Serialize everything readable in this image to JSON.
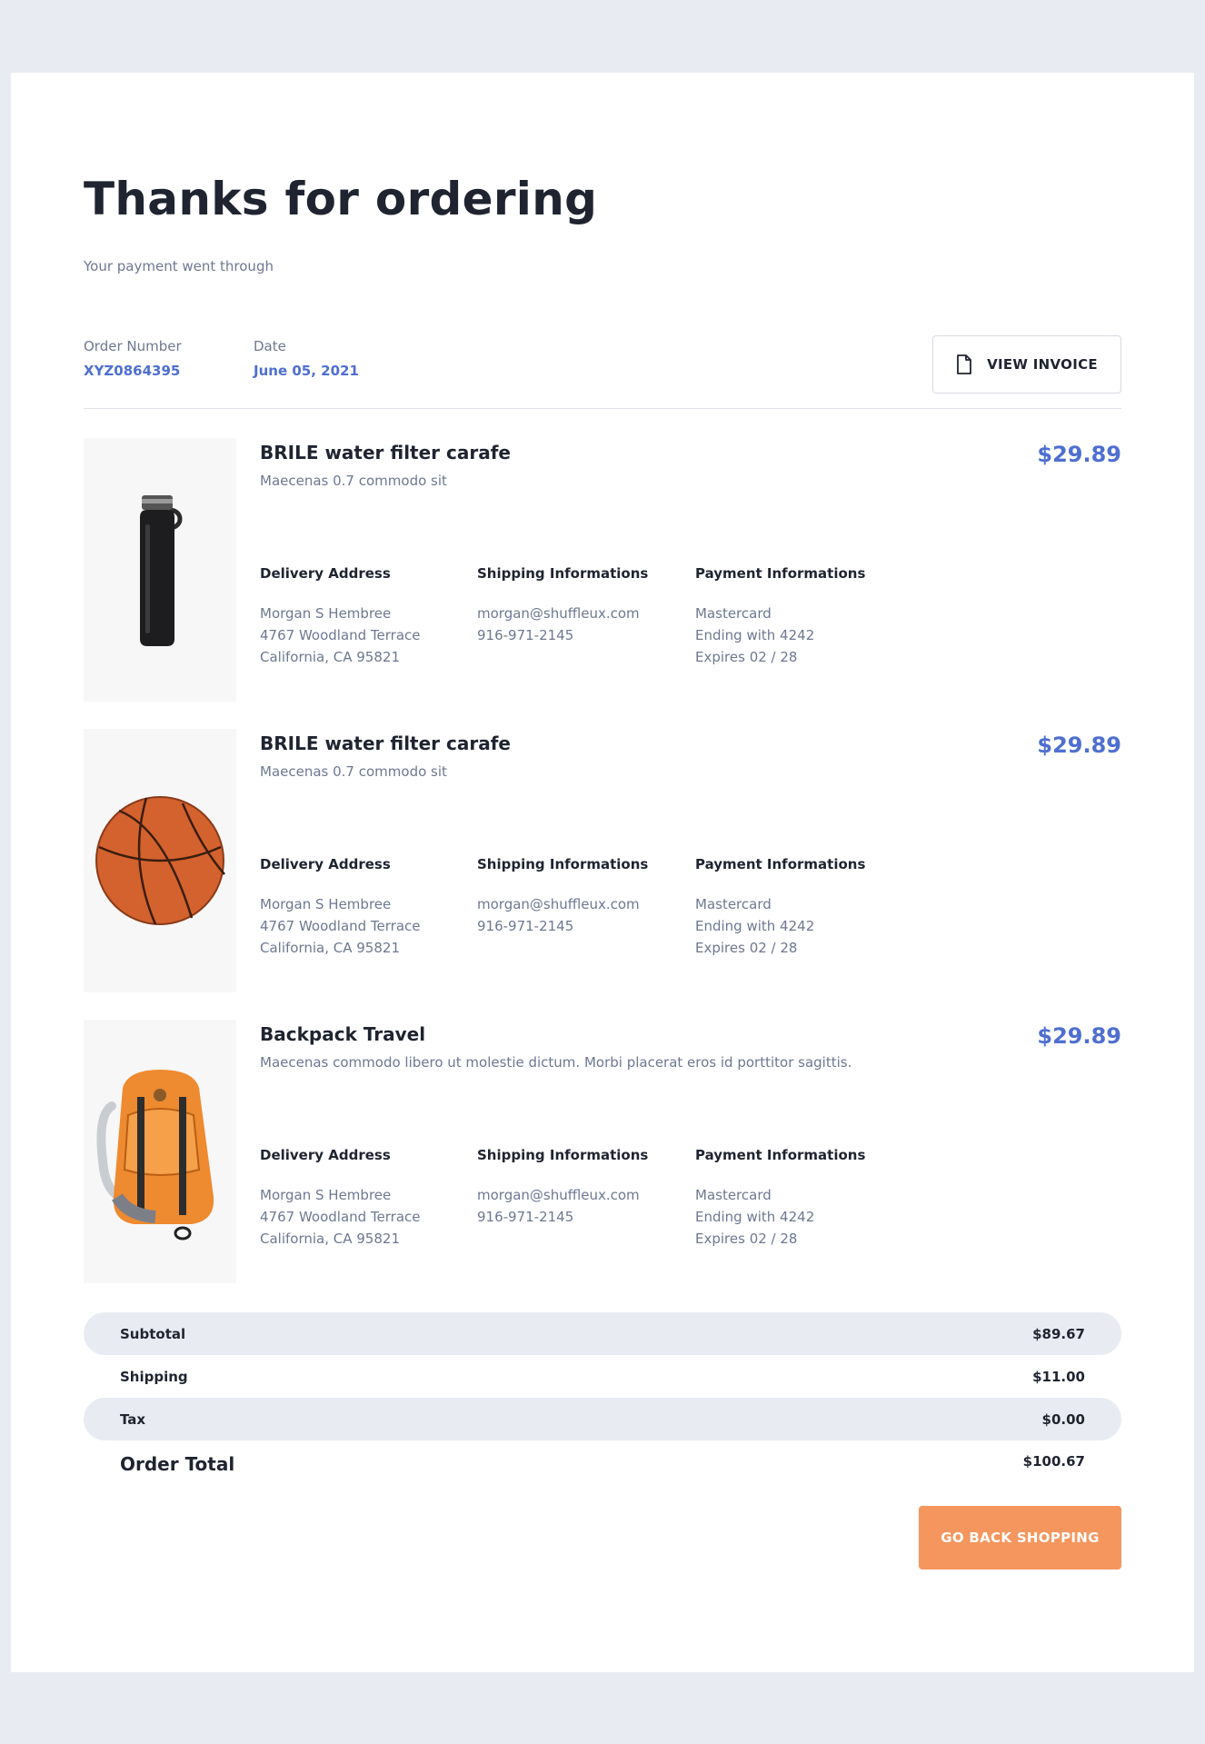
{
  "page": {
    "title": "Thanks for ordering",
    "subtitle": "Your payment went through"
  },
  "order": {
    "number_label": "Order Number",
    "number": "XYZ0864395",
    "date_label": "Date",
    "date": "June 05, 2021",
    "invoice_button": "VIEW INVOICE"
  },
  "colors": {
    "accent": "#4f6fd0",
    "cta": "#f5965e",
    "background": "#e8ecf2"
  },
  "items": [
    {
      "name": "BRILE water filter carafe",
      "description": "Maecenas 0.7 commodo sit",
      "price": "$29.89",
      "image": "water-bottle-image",
      "delivery": {
        "head": "Delivery Address",
        "line1": "Morgan S Hembree",
        "line2": "4767 Woodland Terrace",
        "line3": "California, CA 95821"
      },
      "shipping": {
        "head": "Shipping Informations",
        "line1": "morgan@shuffleux.com",
        "line2": "916-971-2145"
      },
      "payment": {
        "head": "Payment Informations",
        "line1": "Mastercard",
        "line2": "Ending with 4242",
        "line3": "Expires 02 / 28"
      }
    },
    {
      "name": "BRILE water filter carafe",
      "description": "Maecenas 0.7 commodo sit",
      "price": "$29.89",
      "image": "basketball-image",
      "delivery": {
        "head": "Delivery Address",
        "line1": "Morgan S Hembree",
        "line2": "4767 Woodland Terrace",
        "line3": "California, CA 95821"
      },
      "shipping": {
        "head": "Shipping Informations",
        "line1": "morgan@shuffleux.com",
        "line2": "916-971-2145"
      },
      "payment": {
        "head": "Payment Informations",
        "line1": "Mastercard",
        "line2": "Ending with 4242",
        "line3": "Expires 02 / 28"
      }
    },
    {
      "name": "Backpack Travel",
      "description": "Maecenas commodo libero ut molestie dictum. Morbi placerat eros id porttitor sagittis.",
      "price": "$29.89",
      "image": "backpack-image",
      "delivery": {
        "head": "Delivery Address",
        "line1": "Morgan S Hembree",
        "line2": "4767 Woodland Terrace",
        "line3": "California, CA 95821"
      },
      "shipping": {
        "head": "Shipping Informations",
        "line1": "morgan@shuffleux.com",
        "line2": "916-971-2145"
      },
      "payment": {
        "head": "Payment Informations",
        "line1": "Mastercard",
        "line2": "Ending with 4242",
        "line3": "Expires 02 / 28"
      }
    }
  ],
  "summary": {
    "subtotal_label": "Subtotal",
    "subtotal": "$89.67",
    "shipping_label": "Shipping",
    "shipping": "$11.00",
    "tax_label": "Tax",
    "tax": "$0.00",
    "total_label": "Order Total",
    "total": "$100.67"
  },
  "cta": {
    "label": "GO BACK SHOPPING"
  }
}
